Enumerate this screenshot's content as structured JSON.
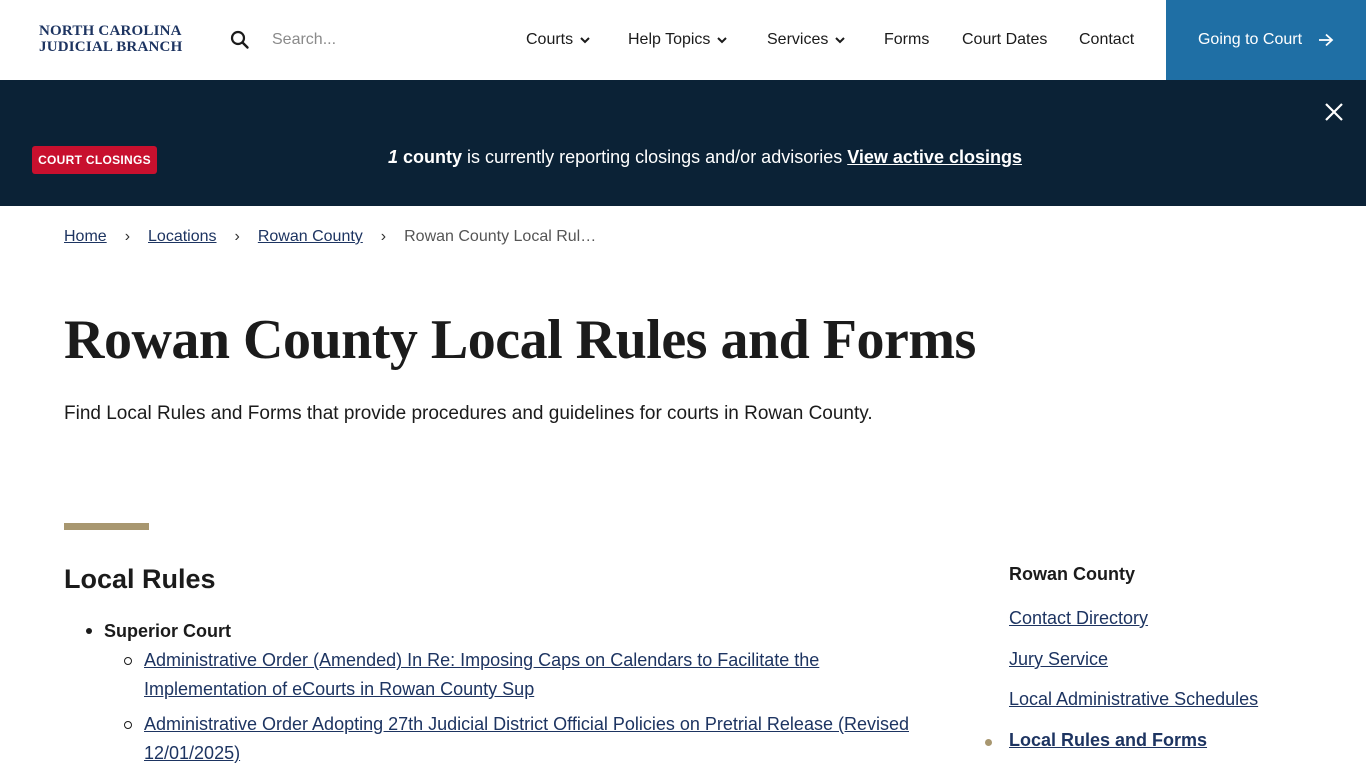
{
  "header": {
    "logo_line1": "NORTH CAROLINA",
    "logo_line2": "JUDICIAL BRANCH",
    "search_placeholder": "Search...",
    "nav": [
      {
        "label": "Courts"
      },
      {
        "label": "Help Topics"
      },
      {
        "label": "Services"
      },
      {
        "label": "Forms"
      },
      {
        "label": "Court Dates"
      },
      {
        "label": "Contact"
      }
    ],
    "cta_label": "Going to Court"
  },
  "alert": {
    "badge": "COURT CLOSINGS",
    "count": "1",
    "count_unit": "county",
    "message": " is currently reporting closings and/or advisories ",
    "link": "View active closings"
  },
  "breadcrumb": {
    "home": "Home",
    "locations": "Locations",
    "county": "Rowan County",
    "current": "Rowan County Local Rul…"
  },
  "main": {
    "title": "Rowan County Local Rules and Forms",
    "intro": "Find Local Rules and Forms that provide procedures and guidelines for courts in Rowan County.",
    "section_title": "Local Rules",
    "group_label": "Superior Court",
    "items": [
      "Administrative Order (Amended) In Re: Imposing Caps on Calendars to Facilitate the Implementation of eCourts in Rowan County Sup",
      "Administrative Order Adopting 27th Judicial District Official Policies on Pretrial Release (Revised 12/01/2025)"
    ]
  },
  "sidebar": {
    "title": "Rowan County",
    "links": [
      "Contact Directory",
      "Jury Service",
      "Local Administrative Schedules",
      "Local Rules and Forms"
    ]
  },
  "colors": {
    "navy": "#0b2236",
    "link": "#1d3461",
    "cta": "#1f6fa5",
    "badge": "#c8102e",
    "accent": "#a89770"
  }
}
